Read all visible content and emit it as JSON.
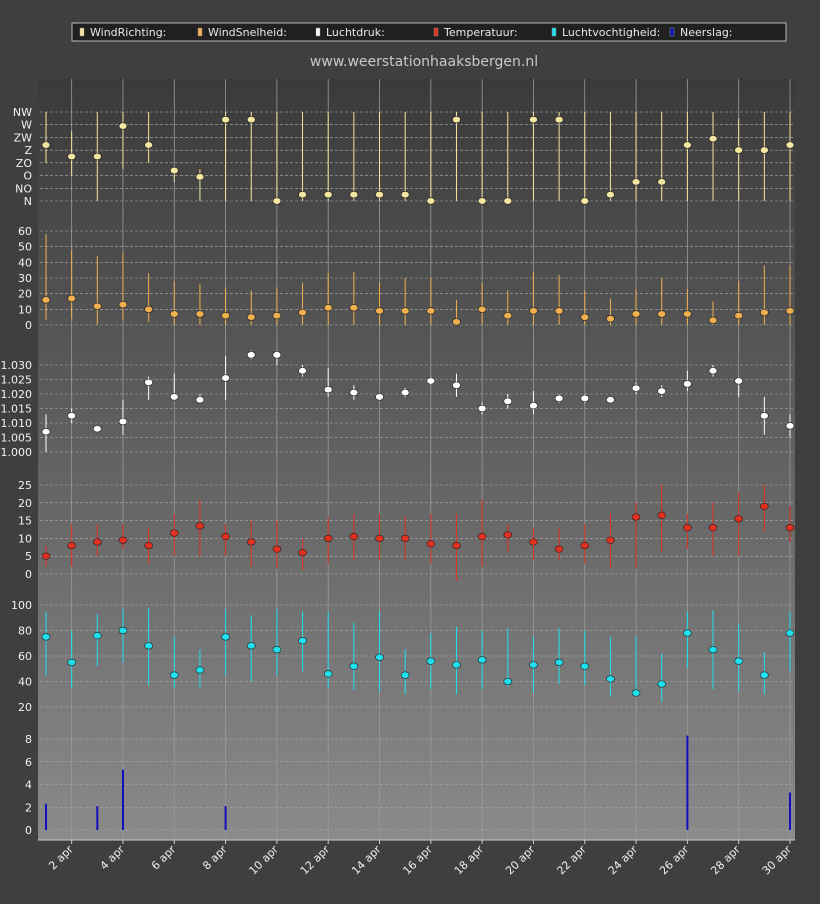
{
  "site_title": "www.weerstationhaaksbergen.nl",
  "legend": [
    {
      "label": "WindRichting:",
      "color": "#f5e6a0"
    },
    {
      "label": "WindSnelheid:",
      "color": "#f0b050"
    },
    {
      "label": "Luchtdruk:",
      "color": "#ffffff"
    },
    {
      "label": "Temperatuur:",
      "color": "#e03020"
    },
    {
      "label": "Luchtvochtigheid:",
      "color": "#20e0f0"
    },
    {
      "label": "Neerslag:",
      "color": "#1010c0"
    }
  ],
  "chart_data": {
    "type": "scatter",
    "x": [
      "1 apr",
      "2 apr",
      "3 apr",
      "4 apr",
      "5 apr",
      "6 apr",
      "7 apr",
      "8 apr",
      "9 apr",
      "10 apr",
      "11 apr",
      "12 apr",
      "13 apr",
      "14 apr",
      "15 apr",
      "16 apr",
      "17 apr",
      "18 apr",
      "19 apr",
      "20 apr",
      "21 apr",
      "22 apr",
      "23 apr",
      "24 apr",
      "25 apr",
      "26 apr",
      "27 apr",
      "28 apr",
      "29 apr",
      "30 apr"
    ],
    "x_tick_labels": [
      "2 apr",
      "4 apr",
      "6 apr",
      "8 apr",
      "10 apr",
      "12 apr",
      "14 apr",
      "16 apr",
      "18 apr",
      "20 apr",
      "22 apr",
      "24 apr",
      "26 apr",
      "28 apr",
      "30 apr"
    ],
    "grid": true,
    "legend_position": "top",
    "panels": [
      {
        "name": "WindRichting",
        "color": "#f5e6a0",
        "tick_labels": [
          "N",
          "NO",
          "O",
          "ZO",
          "Z",
          "ZW",
          "W",
          "NW"
        ],
        "ylim": [
          0,
          7
        ],
        "values": [
          4.4,
          3.5,
          3.5,
          5.9,
          4.4,
          2.4,
          1.9,
          6.4,
          6.4,
          0,
          0.5,
          0.5,
          0.5,
          0.5,
          0.5,
          0,
          6.4,
          0,
          0,
          6.4,
          6.4,
          0,
          0.5,
          1.5,
          1.5,
          4.4,
          4.9,
          4.0,
          4.0,
          4.4
        ],
        "low": [
          3,
          2,
          0,
          2.5,
          3,
          1.5,
          0,
          0,
          0,
          0,
          0,
          0,
          0,
          0,
          0,
          0,
          0,
          0,
          0,
          0,
          0,
          0,
          0,
          0,
          0,
          0,
          0,
          0,
          0,
          0
        ],
        "high": [
          7,
          5.5,
          7,
          7,
          7,
          2.5,
          2.5,
          7,
          7,
          7,
          7,
          7,
          7,
          7,
          7,
          7,
          7,
          7,
          7,
          7,
          7,
          7,
          7,
          7,
          7,
          7,
          7,
          6.5,
          7,
          7
        ]
      },
      {
        "name": "WindSnelheid",
        "color": "#f0b050",
        "tick_labels": [
          "0",
          "10",
          "20",
          "30",
          "40",
          "50",
          "60"
        ],
        "ylim": [
          0,
          60
        ],
        "values": [
          16,
          17,
          12,
          13,
          10,
          7,
          7,
          6,
          5,
          6,
          8,
          11,
          11,
          9,
          9,
          9,
          2,
          10,
          6,
          9,
          9,
          5,
          4,
          7,
          7,
          7,
          3,
          6,
          8,
          9
        ],
        "low": [
          3,
          4,
          0,
          3,
          2,
          0,
          0,
          0,
          0,
          0,
          0,
          0,
          0,
          0,
          0,
          0,
          0,
          0,
          0,
          0,
          0,
          0,
          0,
          0,
          0,
          0,
          0,
          0,
          0,
          0
        ],
        "high": [
          58,
          48,
          44,
          46,
          33,
          28,
          26,
          24,
          22,
          24,
          27,
          33,
          34,
          27,
          30,
          30,
          16,
          27,
          22,
          34,
          32,
          22,
          17,
          23,
          30,
          23,
          15,
          28,
          38,
          38
        ]
      },
      {
        "name": "Luchtdruk",
        "color": "#ffffff",
        "tick_labels": [
          "1.000",
          "1.005",
          "1.010",
          "1.015",
          "1.020",
          "1.025",
          "1.030"
        ],
        "ylim": [
          1.0,
          1.03
        ],
        "values": [
          1.007,
          1.0125,
          1.008,
          1.0105,
          1.024,
          1.019,
          1.018,
          1.0255,
          1.0335,
          1.0335,
          1.028,
          1.0215,
          1.0205,
          1.019,
          1.0205,
          1.0245,
          1.023,
          1.015,
          1.0175,
          1.016,
          1.0185,
          1.0185,
          1.018,
          1.022,
          1.021,
          1.0235,
          1.028,
          1.0245,
          1.0125,
          1.009
        ],
        "low": [
          1.0,
          1.01,
          1.007,
          1.006,
          1.018,
          1.018,
          1.017,
          1.018,
          1.032,
          1.03,
          1.026,
          1.019,
          1.018,
          1.018,
          1.019,
          1.023,
          1.019,
          1.013,
          1.015,
          1.013,
          1.017,
          1.017,
          1.017,
          1.02,
          1.019,
          1.021,
          1.026,
          1.019,
          1.006,
          1.005
        ],
        "high": [
          1.013,
          1.015,
          1.009,
          1.018,
          1.026,
          1.027,
          1.02,
          1.033,
          1.035,
          1.035,
          1.03,
          1.029,
          1.023,
          1.02,
          1.022,
          1.026,
          1.027,
          1.017,
          1.02,
          1.021,
          1.02,
          1.02,
          1.019,
          1.024,
          1.023,
          1.028,
          1.03,
          1.026,
          1.019,
          1.013
        ]
      },
      {
        "name": "Temperatuur",
        "color": "#e03020",
        "tick_labels": [
          "0",
          "5",
          "10",
          "15",
          "20",
          "25"
        ],
        "ylim": [
          0,
          25
        ],
        "values": [
          5,
          8,
          9,
          9.5,
          8,
          11.5,
          13.5,
          10.5,
          9,
          7,
          6,
          10,
          10.5,
          10,
          10,
          8.5,
          8,
          10.5,
          11,
          9,
          7,
          8,
          9.5,
          16,
          16.5,
          13,
          13,
          15.5,
          19,
          13
        ],
        "low": [
          2,
          2,
          5,
          7,
          3,
          5,
          5,
          5,
          2,
          1.5,
          1,
          3,
          4,
          4,
          4,
          3,
          -2,
          2,
          6,
          4,
          4,
          3,
          1.5,
          1.5,
          6,
          7,
          5,
          5,
          12,
          9
        ],
        "high": [
          8,
          14,
          14,
          14,
          13,
          17,
          21,
          14,
          15,
          15,
          10,
          16,
          17,
          17,
          16,
          17,
          17,
          21,
          14,
          13,
          13,
          14,
          17,
          20,
          25,
          17,
          20,
          23,
          25,
          19
        ]
      },
      {
        "name": "Luchtvochtigheid",
        "color": "#20e0f0",
        "tick_labels": [
          "20",
          "40",
          "60",
          "80",
          "100"
        ],
        "ylim": [
          20,
          100
        ],
        "values": [
          75,
          55,
          76,
          80,
          68,
          45,
          49,
          75,
          68,
          65,
          72,
          46,
          52,
          59,
          45,
          56,
          53,
          57,
          40,
          53,
          55,
          52,
          42,
          31,
          38,
          78,
          65,
          56,
          45,
          78
        ],
        "low": [
          45,
          35,
          52,
          55,
          37,
          35,
          35,
          45,
          40,
          45,
          48,
          35,
          33,
          32,
          30,
          34,
          30,
          34,
          36,
          31,
          38,
          37,
          28,
          28,
          24,
          51,
          34,
          32,
          30,
          48
        ],
        "high": [
          95,
          80,
          93,
          97,
          98,
          75,
          65,
          97,
          92,
          97,
          95,
          95,
          86,
          95,
          65,
          78,
          83,
          80,
          82,
          75,
          82,
          80,
          75,
          75,
          62,
          95,
          96,
          85,
          63,
          95
        ]
      },
      {
        "name": "Neerslag",
        "color": "#1010c0",
        "tick_labels": [
          "0",
          "2",
          "4",
          "6",
          "8"
        ],
        "ylim": [
          0,
          8
        ],
        "values": [
          2.3,
          0,
          2.1,
          5.3,
          0,
          0,
          0,
          2.1,
          0,
          0,
          0,
          0,
          0,
          0,
          0,
          0,
          0,
          0,
          0,
          0,
          0,
          0,
          0,
          0,
          0,
          8.3,
          0,
          0,
          0,
          3.3
        ]
      }
    ]
  }
}
